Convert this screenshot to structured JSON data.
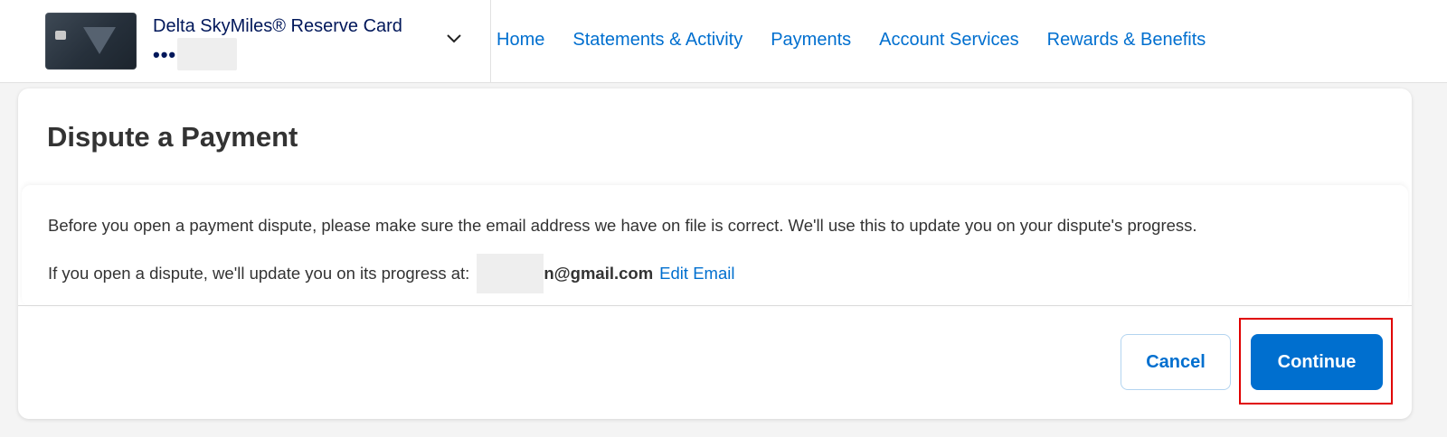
{
  "card": {
    "name": "Delta SkyMiles® Reserve Card",
    "masked_number": "•••"
  },
  "nav": {
    "items": [
      {
        "label": "Home"
      },
      {
        "label": "Statements & Activity"
      },
      {
        "label": "Payments"
      },
      {
        "label": "Account Services"
      },
      {
        "label": "Rewards & Benefits"
      }
    ]
  },
  "dialog": {
    "title": "Dispute a Payment",
    "message": "Before you open a payment dispute, please make sure the email address we have on file is correct. We'll use this to update you on your dispute's progress.",
    "email_prefix_text": "If you open a dispute, we'll update you on its progress at:",
    "email_domain": "n@gmail.com",
    "edit_email_label": "Edit Email",
    "cancel_label": "Cancel",
    "continue_label": "Continue"
  },
  "colors": {
    "brand_blue": "#006fcf",
    "navy": "#00175a",
    "highlight": "#e00000"
  },
  "icons": {
    "card_switch": "chevron-down-icon"
  }
}
